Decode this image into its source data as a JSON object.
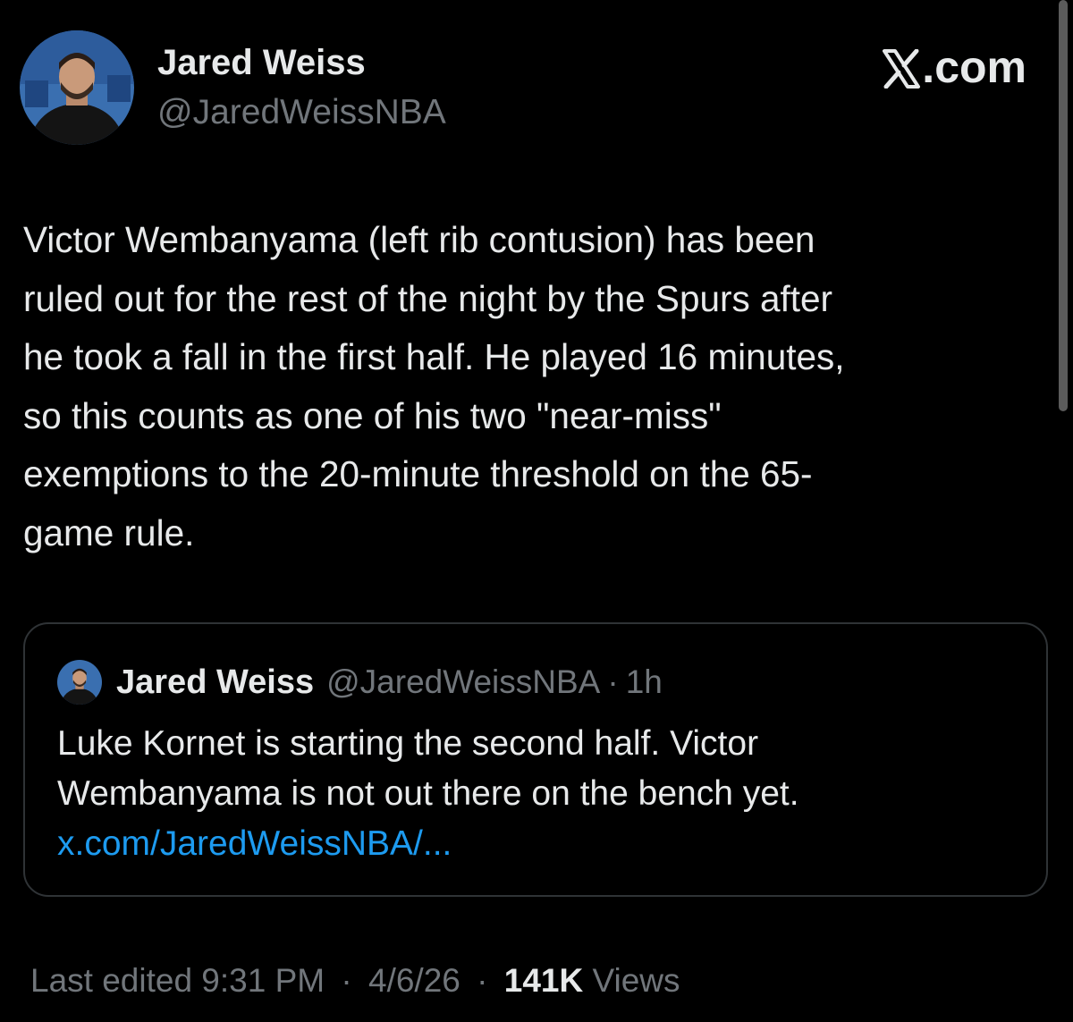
{
  "author": {
    "display_name": "Jared Weiss",
    "handle": "@JaredWeissNBA"
  },
  "brand": {
    "label": ".com",
    "icon": "x-logo-icon"
  },
  "tweet": {
    "text": "Victor Wembanyama (left rib contusion) has been\nruled out for the rest of the night by the Spurs after\nhe took a fall in the first half. He played 16 minutes,\nso this counts as one of his two \"near-miss\"\nexemptions to the 20-minute threshold on the 65-\ngame rule."
  },
  "quoted_tweet": {
    "display_name": "Jared Weiss",
    "handle": "@JaredWeissNBA",
    "separator": "·",
    "time": "1h",
    "text": "Luke Kornet is starting the second half. Victor\nWembanyama is not out there on the bench yet.",
    "link": "x.com/JaredWeissNBA/..."
  },
  "meta": {
    "edited_label": "Last edited 9:31 PM",
    "separator": "·",
    "date": "4/6/26",
    "views_count": "141K",
    "views_label": "Views"
  },
  "colors": {
    "background": "#000000",
    "text_primary": "#e7e9ea",
    "text_secondary": "#71767b",
    "link": "#1d9bf0",
    "border": "#2f3336"
  }
}
